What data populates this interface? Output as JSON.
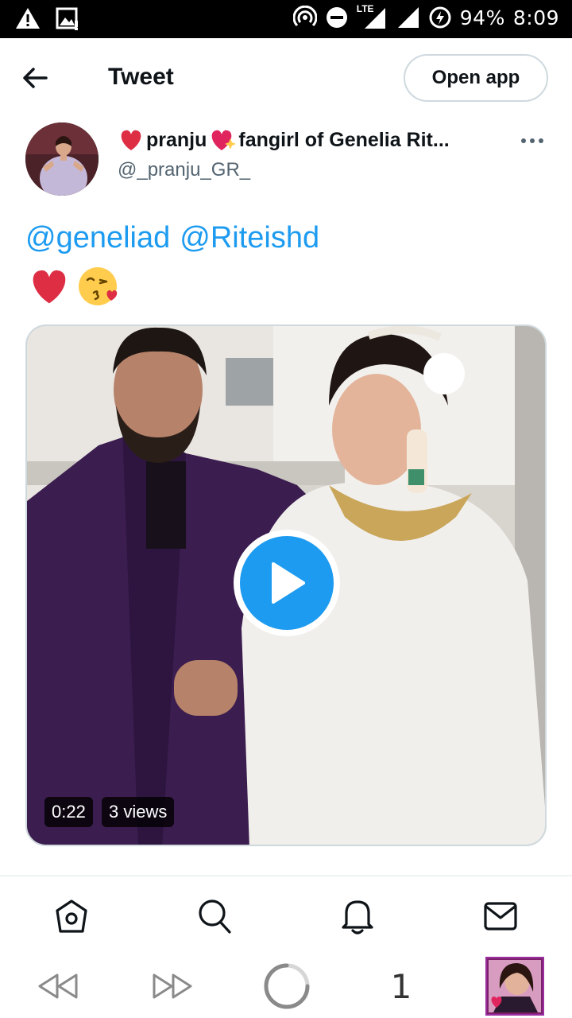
{
  "status_bar": {
    "network": "LTE",
    "battery": "94%",
    "time": "8:09",
    "icons": [
      "warning-icon",
      "image-notification-icon",
      "hotspot-icon",
      "do-not-disturb-icon",
      "lte-signal-icon",
      "signal-icon",
      "battery-saver-icon"
    ]
  },
  "header": {
    "title": "Tweet",
    "open_app_label": "Open app",
    "back_icon": "arrow-left-icon"
  },
  "tweet": {
    "author_prefix_emoji": "❤",
    "author_name_part1": "pranju",
    "author_mid_emoji": "💖",
    "author_name_part2": "fangirl of Genelia Rit...",
    "handle": "@_pranju_GR_",
    "mentions": [
      "@geneliad",
      "@Riteishd"
    ],
    "emojis": [
      "red-heart-emoji",
      "face-blowing-kiss-emoji"
    ],
    "media": {
      "duration": "0:22",
      "views": "3 views",
      "play_icon": "play-icon"
    }
  },
  "bottom_nav": {
    "items": [
      "home-icon",
      "search-icon",
      "notifications-icon",
      "messages-icon"
    ]
  },
  "browser_toolbar": {
    "tab_count": "1",
    "items": [
      "rewind-icon",
      "fast-forward-icon",
      "loading-icon",
      "tab-count",
      "profile-thumbnail"
    ]
  },
  "colors": {
    "accent": "#1d9bf0",
    "text": "#0f1419",
    "secondary": "#536471",
    "border": "#cfd9de"
  }
}
